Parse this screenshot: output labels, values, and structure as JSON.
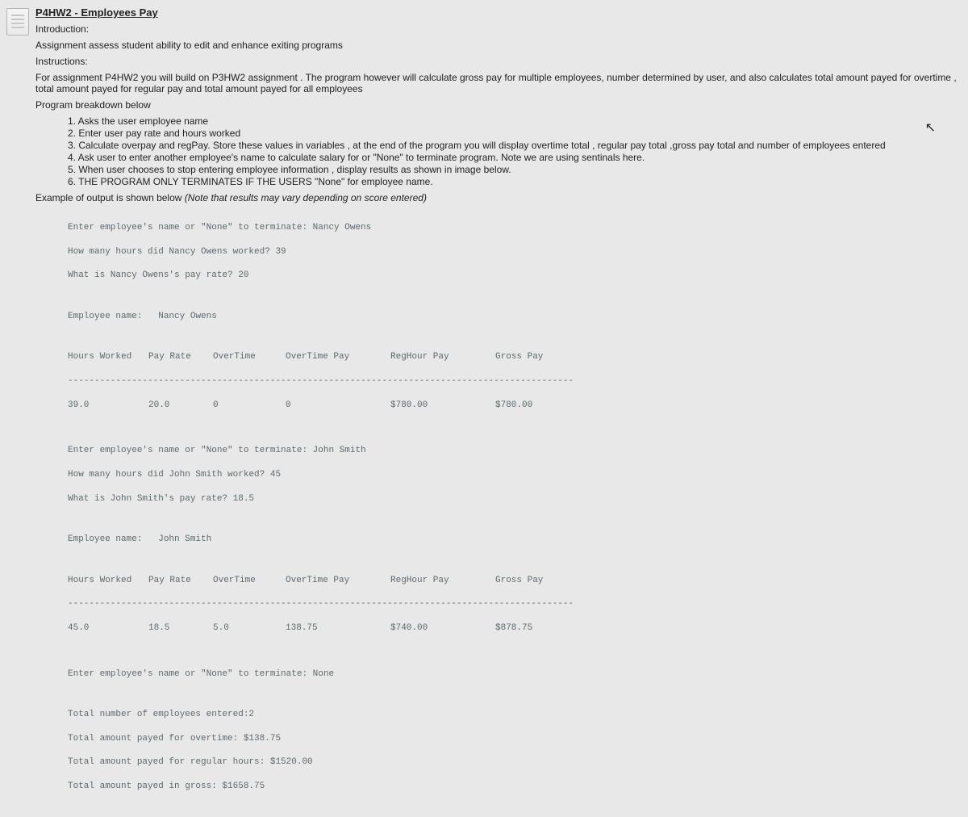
{
  "title": "P4HW2 - Employees Pay",
  "intro_label": "Introduction:",
  "intro_text": "Assignment assess student ability to edit and enhance exiting programs",
  "instructions_label": "Instructions:",
  "instructions_text": "For assignment P4HW2 you will build on P3HW2 assignment . The program however will calculate gross pay for multiple employees, number determined by user, and also calculates total amount payed for overtime , total amount payed for regular pay and total amount payed for all employees",
  "program_breakdown_label": "Program breakdown below",
  "breakdown": [
    "1. Asks the user employee name",
    "2. Enter user pay rate and hours worked",
    "3. Calculate overpay and regPay. Store these values in variables , at the end of the program you will display overtime total , regular pay total ,gross pay total and number of employees entered",
    "4. Ask user to enter another employee's name to calculate salary for or \"None\" to terminate program. Note we are using sentinals here.",
    "5. When user chooses to stop entering employee information , display results as shown in image below.",
    "6. THE PROGRAM ONLY TERMINATES IF THE USERS \"None\" for employee name."
  ],
  "example_label": "Example of output is shown below ",
  "example_note": "(Note that results may vary depending on score entered)",
  "output": {
    "emp1": {
      "prompt_name": "Enter employee's name or \"None\" to terminate: Nancy Owens",
      "prompt_hours": "How many hours did Nancy Owens worked? 39",
      "prompt_rate": "What is Nancy Owens's pay rate? 20",
      "emp_label": "Employee name:",
      "emp_name": "Nancy Owens",
      "headers": {
        "h1": "Hours Worked",
        "h2": "Pay Rate",
        "h3": "OverTime",
        "h4": "OverTime Pay",
        "h5": "RegHour Pay",
        "h6": "Gross Pay"
      },
      "values": {
        "v1": "39.0",
        "v2": "20.0",
        "v3": "0",
        "v4": "0",
        "v5": "$780.00",
        "v6": "$780.00"
      }
    },
    "emp2": {
      "prompt_name": "Enter employee's name or \"None\" to terminate: John Smith",
      "prompt_hours": "How many hours did John Smith worked? 45",
      "prompt_rate": "What is John Smith's pay rate? 18.5",
      "emp_label": "Employee name:",
      "emp_name": "John Smith",
      "headers": {
        "h1": "Hours Worked",
        "h2": "Pay Rate",
        "h3": "OverTime",
        "h4": "OverTime Pay",
        "h5": "RegHour Pay",
        "h6": "Gross Pay"
      },
      "values": {
        "v1": "45.0",
        "v2": "18.5",
        "v3": "5.0",
        "v4": "138.75",
        "v5": "$740.00",
        "v6": "$878.75"
      }
    },
    "terminate": "Enter employee's name or \"None\" to terminate: None",
    "totals": {
      "t1": "Total number of employees entered:2",
      "t2": "Total amount payed for overtime: $138.75",
      "t3": "Total amount payed for regular hours: $1520.00",
      "t4": "Total amount payed in gross: $1658.75"
    }
  }
}
